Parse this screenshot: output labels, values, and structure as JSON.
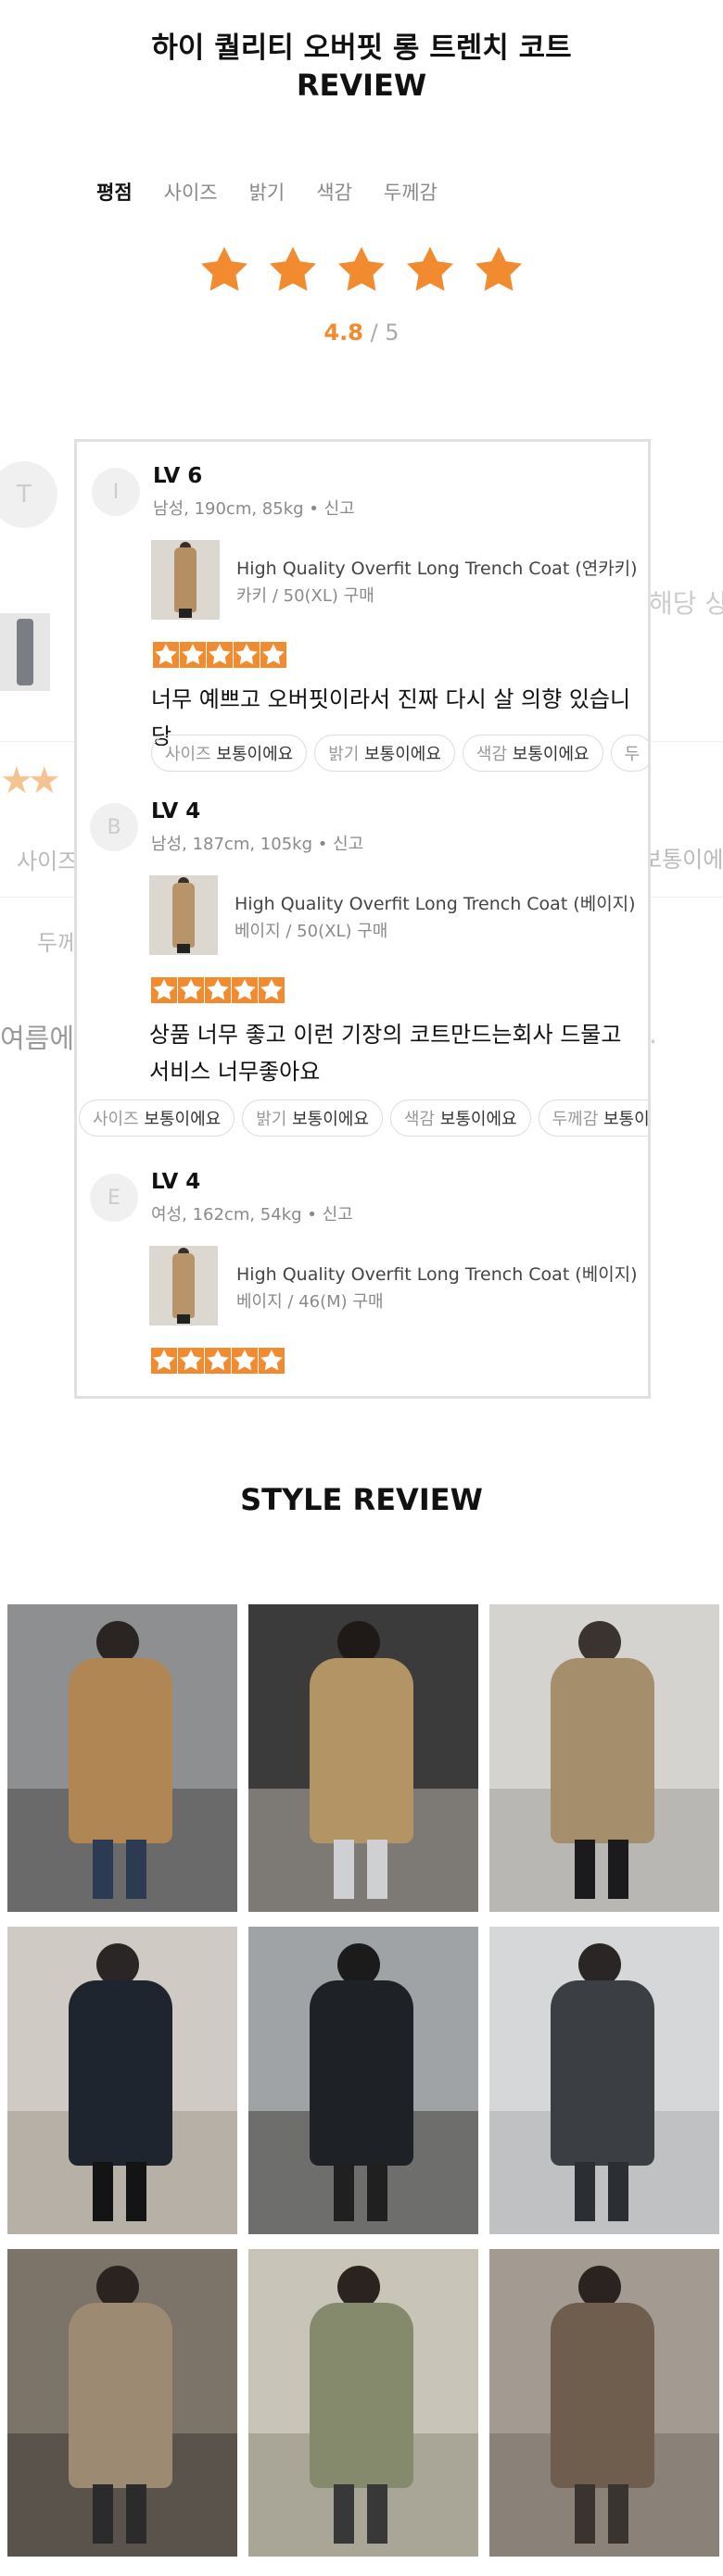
{
  "header": {
    "title": "하이 퀄리티 오버핏 롱 트렌치 코트",
    "subtitle": "REVIEW"
  },
  "tabs": [
    {
      "label": "평점",
      "active": true
    },
    {
      "label": "사이즈",
      "active": false
    },
    {
      "label": "밝기",
      "active": false
    },
    {
      "label": "색감",
      "active": false
    },
    {
      "label": "두께감",
      "active": false
    }
  ],
  "rating": {
    "stars": 5,
    "value": "4.8",
    "separator": "/",
    "max": "5",
    "star_color": "#f28b30"
  },
  "background": {
    "avatar_letter": "T",
    "text_right": "해당 상",
    "chip_left": "사이즈",
    "chip_right": "보통이에",
    "chip_left2": "두께",
    "text_left": "여름에",
    "text_right2": "."
  },
  "reviews": [
    {
      "avatar": "I",
      "level": "LV 6",
      "meta": "남성, 190cm, 85kg • 신고",
      "product_name": "High Quality Overfit Long Trench Coat (연카키)",
      "product_option": "카키 / 50(XL) 구매",
      "stars": 5,
      "text": "너무 예쁘고 오버핏이라서 진짜 다시 살 의향 있습니당",
      "chips": [
        {
          "key": "사이즈",
          "value": "보통이에요"
        },
        {
          "key": "밝기",
          "value": "보통이에요"
        },
        {
          "key": "색감",
          "value": "보통이에요"
        },
        {
          "key": "두",
          "value": ""
        }
      ]
    },
    {
      "avatar": "B",
      "level": "LV 4",
      "meta": "남성, 187cm, 105kg • 신고",
      "product_name": "High Quality Overfit Long Trench Coat (베이지)",
      "product_option": "베이지 / 50(XL) 구매",
      "stars": 5,
      "text": "상품 너무 좋고 이런 기장의 코트만드는회사 드물고 서비스 너무좋아요",
      "chips": [
        {
          "key": "사이즈",
          "value": "보통이에요"
        },
        {
          "key": "밝기",
          "value": "보통이에요"
        },
        {
          "key": "색감",
          "value": "보통이에요"
        },
        {
          "key": "두께감",
          "value": "보통이"
        }
      ]
    },
    {
      "avatar": "E",
      "level": "LV 4",
      "meta": "여성, 162cm, 54kg • 신고",
      "product_name": "High Quality Overfit Long Trench Coat (베이지)",
      "product_option": "베이지 / 46(M) 구매",
      "stars": 5,
      "text": "",
      "chips": []
    }
  ],
  "style_review": {
    "title": "STYLE REVIEW",
    "photos": [
      {
        "name": "photo-beige-coat-wall"
      },
      {
        "name": "photo-beige-coat-mirror"
      },
      {
        "name": "photo-beige-coat-store"
      },
      {
        "name": "photo-black-coat-mirror"
      },
      {
        "name": "photo-black-coat-street"
      },
      {
        "name": "photo-black-coat-closeup"
      },
      {
        "name": "photo-beige-coat-storefront"
      },
      {
        "name": "photo-olive-coat"
      },
      {
        "name": "photo-brown-coat-closeup"
      }
    ]
  }
}
